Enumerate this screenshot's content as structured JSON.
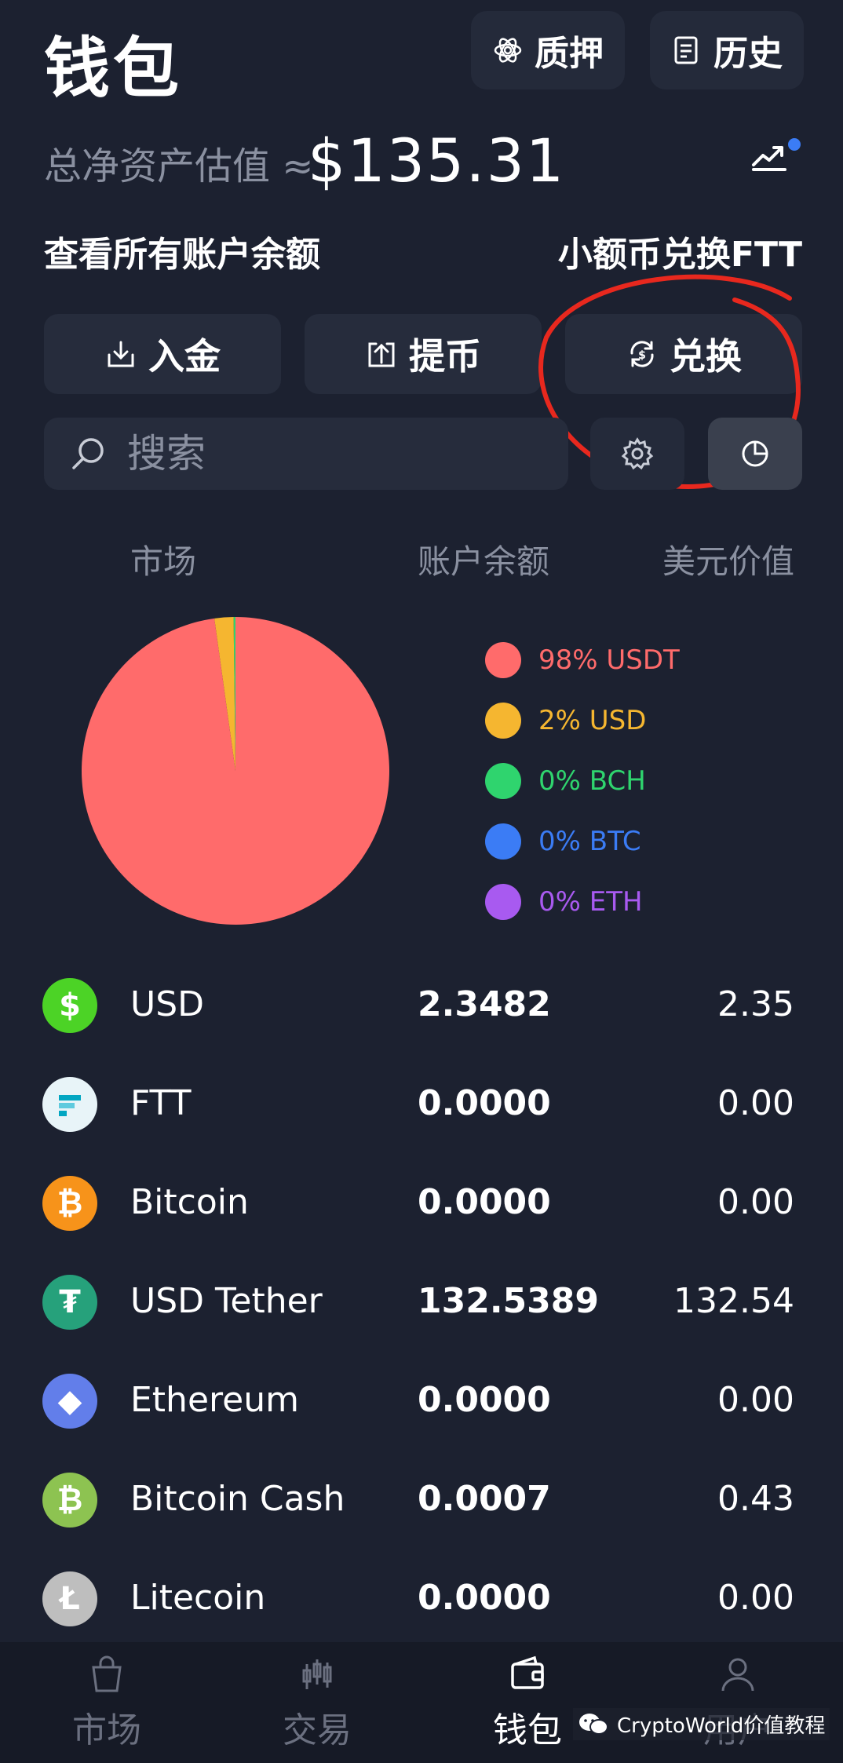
{
  "header": {
    "title": "钱包",
    "stake_label": "质押",
    "history_label": "历史"
  },
  "summary": {
    "net_label": "总净资产估值 ≈",
    "net_value": "$135.31"
  },
  "links": {
    "all_balances": "查看所有账户余额",
    "dust_convert": "小额币兑换FTT"
  },
  "actions": {
    "deposit": "入金",
    "withdraw": "提币",
    "convert": "兑换"
  },
  "search": {
    "placeholder": "搜索"
  },
  "columns": {
    "market": "市场",
    "balance": "账户余额",
    "usd_value": "美元价值"
  },
  "chart_data": {
    "type": "pie",
    "slices": [
      {
        "label": "98% USDT",
        "value": 98,
        "color": "#ff6b6b"
      },
      {
        "label": "2% USD",
        "value": 2,
        "color": "#f5b630"
      },
      {
        "label": "0% BCH",
        "value": 0.2,
        "color": "#2fd46e"
      },
      {
        "label": "0% BTC",
        "value": 0,
        "color": "#3b7cf5"
      },
      {
        "label": "0% ETH",
        "value": 0,
        "color": "#a85af0"
      }
    ]
  },
  "coins": [
    {
      "name": "USD",
      "balance": "2.3482",
      "usd": "2.35",
      "icon": "$",
      "color": "#4cd326"
    },
    {
      "name": "FTT",
      "balance": "0.0000",
      "usd": "0.00",
      "icon": "ftt",
      "color": "#e8f4f8"
    },
    {
      "name": "Bitcoin",
      "balance": "0.0000",
      "usd": "0.00",
      "icon": "₿",
      "color": "#f7931a"
    },
    {
      "name": "USD Tether",
      "balance": "132.5389",
      "usd": "132.54",
      "icon": "₮",
      "color": "#26a17b"
    },
    {
      "name": "Ethereum",
      "balance": "0.0000",
      "usd": "0.00",
      "icon": "◆",
      "color": "#627eea"
    },
    {
      "name": "Bitcoin Cash",
      "balance": "0.0007",
      "usd": "0.43",
      "icon": "₿",
      "color": "#8dc351"
    },
    {
      "name": "Litecoin",
      "balance": "0.0000",
      "usd": "0.00",
      "icon": "Ł",
      "color": "#bebebe"
    }
  ],
  "nav": {
    "market": "市场",
    "trade": "交易",
    "wallet": "钱包",
    "user": "用户"
  },
  "watermark": "CryptoWorld价值教程"
}
